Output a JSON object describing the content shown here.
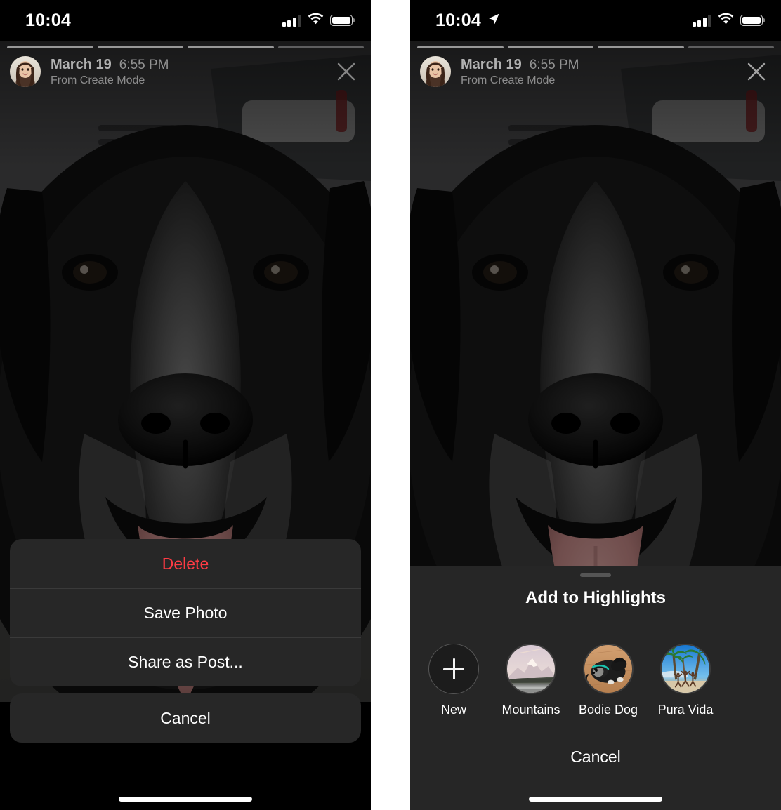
{
  "left": {
    "status_bar": {
      "time": "10:04",
      "location_arrow": false,
      "cellular_icon": "cellular-bars-icon",
      "wifi_icon": "wifi-icon",
      "battery_icon": "battery-full-icon"
    },
    "story": {
      "progress_segments": 4,
      "progress_active_index": 3,
      "avatar_name": "user-avatar",
      "date": "March 19",
      "time": "6:55 PM",
      "subtitle": "From Create Mode",
      "close_icon": "close-icon",
      "media_alt": "Close-up photo of a black and white border collie dog with tongue out inside a car"
    },
    "action_sheet": {
      "items": [
        {
          "label": "Delete",
          "style": "destructive"
        },
        {
          "label": "Save Photo",
          "style": "default"
        },
        {
          "label": "Share as Post...",
          "style": "default"
        }
      ],
      "cancel_label": "Cancel"
    }
  },
  "right": {
    "status_bar": {
      "time": "10:04",
      "location_arrow": true,
      "cellular_icon": "cellular-bars-icon",
      "wifi_icon": "wifi-icon",
      "battery_icon": "battery-full-icon"
    },
    "story": {
      "progress_segments": 4,
      "progress_active_index": 3,
      "avatar_name": "user-avatar",
      "date": "March 19",
      "time": "6:55 PM",
      "subtitle": "From Create Mode",
      "close_icon": "close-icon",
      "media_alt": "Close-up photo of a black and white border collie dog with tongue out inside a car"
    },
    "highlights_sheet": {
      "title": "Add to Highlights",
      "items": [
        {
          "label": "New",
          "thumb": "plus-icon"
        },
        {
          "label": "Mountains",
          "thumb": "mountain-photo"
        },
        {
          "label": "Bodie Dog",
          "thumb": "dog-photo"
        },
        {
          "label": "Pura Vida",
          "thumb": "palm-beach-photo"
        }
      ],
      "cancel_label": "Cancel"
    }
  },
  "colors": {
    "destructive": "#ff3b44",
    "sheet_background": "#272727",
    "sheet_background_right": "#262626",
    "text_primary": "#ffffff",
    "panel_background": "#000000"
  }
}
